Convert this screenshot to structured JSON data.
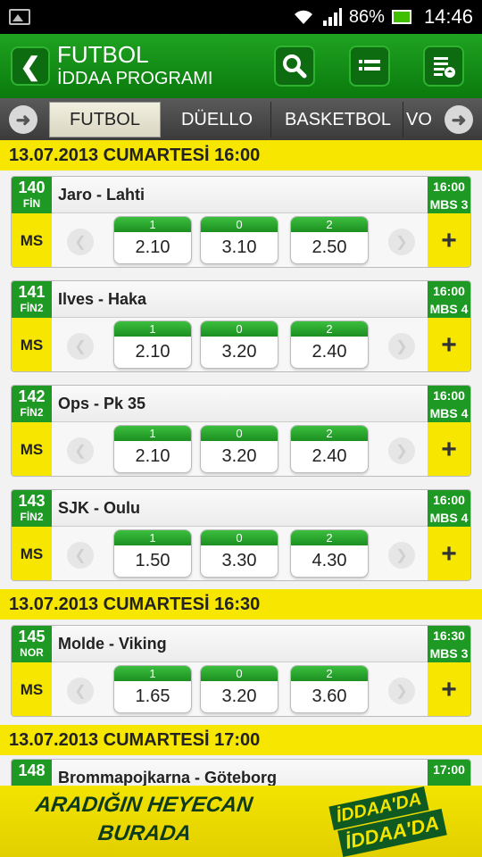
{
  "status_bar": {
    "battery": "86%",
    "time": "14:46"
  },
  "header": {
    "title": "FUTBOL",
    "subtitle": "İDDAA PROGRAMI"
  },
  "tabs": [
    {
      "label": "FUTBOL",
      "active": true
    },
    {
      "label": "DÜELLO",
      "active": false
    },
    {
      "label": "BASKETBOL",
      "active": false
    },
    {
      "label": "VO",
      "active": false
    }
  ],
  "dates": [
    "13.07.2013 CUMARTESİ 16:00",
    "13.07.2013 CUMARTESİ 16:30",
    "13.07.2013 CUMARTESİ 17:00"
  ],
  "matches": [
    {
      "code": "140",
      "league": "FİN",
      "name": "Jaro - Lahti",
      "time": "16:00",
      "mbs": "MBS 3",
      "bet_type": "MS",
      "odds": [
        {
          "label": "1",
          "value": "2.10"
        },
        {
          "label": "0",
          "value": "3.10"
        },
        {
          "label": "2",
          "value": "2.50"
        }
      ]
    },
    {
      "code": "141",
      "league": "FİN2",
      "name": "Ilves - Haka",
      "time": "16:00",
      "mbs": "MBS 4",
      "bet_type": "MS",
      "odds": [
        {
          "label": "1",
          "value": "2.10"
        },
        {
          "label": "0",
          "value": "3.20"
        },
        {
          "label": "2",
          "value": "2.40"
        }
      ]
    },
    {
      "code": "142",
      "league": "FİN2",
      "name": "Ops - Pk 35",
      "time": "16:00",
      "mbs": "MBS 4",
      "bet_type": "MS",
      "odds": [
        {
          "label": "1",
          "value": "2.10"
        },
        {
          "label": "0",
          "value": "3.20"
        },
        {
          "label": "2",
          "value": "2.40"
        }
      ]
    },
    {
      "code": "143",
      "league": "FİN2",
      "name": "SJK - Oulu",
      "time": "16:00",
      "mbs": "MBS 4",
      "bet_type": "MS",
      "odds": [
        {
          "label": "1",
          "value": "1.50"
        },
        {
          "label": "0",
          "value": "3.30"
        },
        {
          "label": "2",
          "value": "4.30"
        }
      ]
    },
    {
      "code": "145",
      "league": "NOR",
      "name": "Molde - Viking",
      "time": "16:30",
      "mbs": "MBS 3",
      "bet_type": "MS",
      "odds": [
        {
          "label": "1",
          "value": "1.65"
        },
        {
          "label": "0",
          "value": "3.20"
        },
        {
          "label": "2",
          "value": "3.60"
        }
      ]
    },
    {
      "code": "148",
      "name": "Brommapojkarna - Göteborg",
      "time": "17:00"
    }
  ],
  "banner": {
    "line1": "ARADIĞIN HEYECAN",
    "line2": "BURADA",
    "logo_line1": "İDDAA'DA",
    "logo_line2": "İDDAA'DA"
  },
  "colors": {
    "green": "#1e9a24",
    "yellow": "#f7e600"
  }
}
